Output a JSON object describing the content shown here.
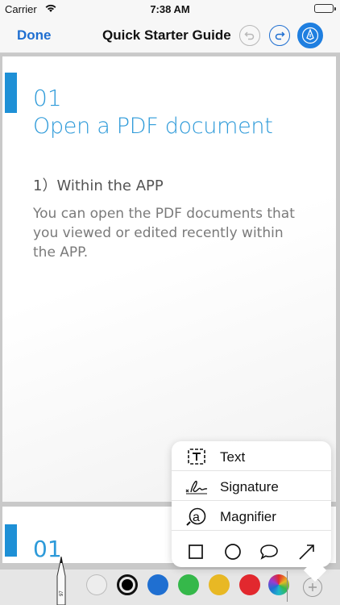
{
  "status_bar": {
    "carrier": "Carrier",
    "time": "7:38 AM"
  },
  "nav": {
    "done_label": "Done",
    "title": "Quick Starter Guide",
    "undo_icon": "undo-icon",
    "redo_icon": "redo-icon",
    "markup_icon": "pen-tip-icon"
  },
  "page": {
    "number": "01",
    "heading": "Open a PDF document",
    "subheading": "1）Within the APP",
    "body": "You can open the PDF documents that you viewed or edited recently within the APP."
  },
  "next_page": {
    "number": "01"
  },
  "popup": {
    "items": [
      {
        "label": "Text",
        "icon": "text-box-icon"
      },
      {
        "label": "Signature",
        "icon": "signature-icon"
      },
      {
        "label": "Magnifier",
        "icon": "magnifier-icon"
      }
    ],
    "shapes": [
      "square-icon",
      "circle-icon",
      "speech-bubble-icon",
      "arrow-icon"
    ]
  },
  "toolbar": {
    "pen_label": "97",
    "colors": [
      "#ededed",
      "#000000",
      "#1f6fd1",
      "#35b84a",
      "#e8b824",
      "#e2282e"
    ],
    "selected_color": "#000000",
    "accent": "#1f7fe0"
  }
}
